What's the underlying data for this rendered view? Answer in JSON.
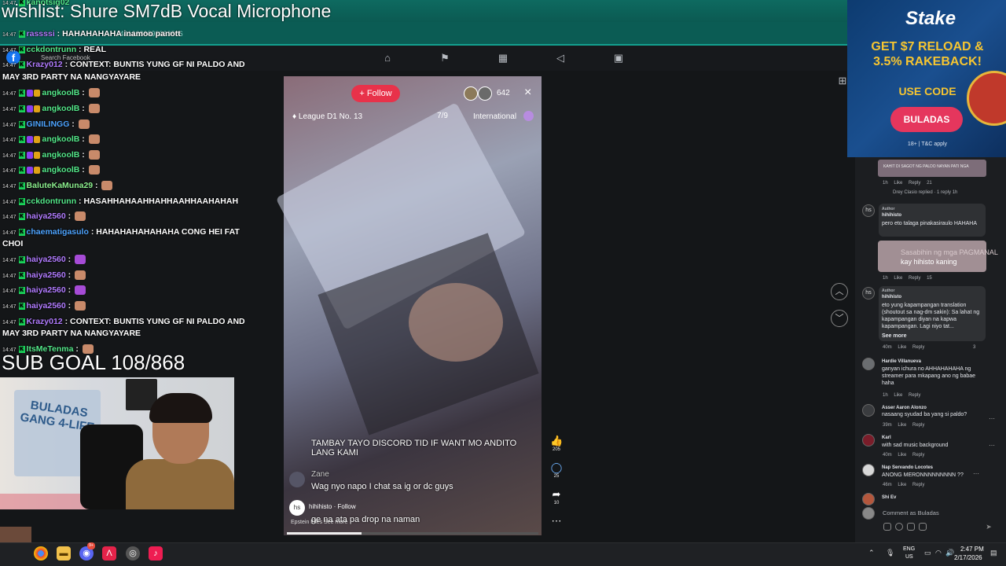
{
  "overlay": {
    "wishlist": "wishlist: Shure SM7dB Vocal Microphone",
    "sub_goal": "SUB GOAL 108/868",
    "counter": "x308",
    "url_fragment": "/4416683893333536",
    "search_placeholder": "Search Facebook"
  },
  "chat": {
    "lines": [
      {
        "time": "14:47",
        "user": "kanotsig02",
        "msg": ""
      },
      {
        "time": "14:47",
        "user": "rassssi",
        "msg": "HAHAHAHAHA inamoo panott"
      },
      {
        "time": "14:47",
        "user": "cckdontrunn",
        "msg": "REAL"
      },
      {
        "time": "14:47",
        "user": "Krazy012",
        "msg": "CONTEXT: BUNTIS YUNG GF NI PALDO AND",
        "cont": "MAY 3RD PARTY NA NANGYAYARE"
      },
      {
        "time": "14:47",
        "user": "angkoolB",
        "msg": ""
      },
      {
        "time": "14:47",
        "user": "angkoolB",
        "msg": ""
      },
      {
        "time": "14:47",
        "user": "GINILINGG",
        "msg": ""
      },
      {
        "time": "14:47",
        "user": "angkoolB",
        "msg": ""
      },
      {
        "time": "14:47",
        "user": "angkoolB",
        "msg": ""
      },
      {
        "time": "14:47",
        "user": "angkoolB",
        "msg": ""
      },
      {
        "time": "14:47",
        "user": "BaluteKaMuna29",
        "msg": ""
      },
      {
        "time": "14:47",
        "user": "cckdontrunn",
        "msg": "HASAHHAHAAHHAHHAAHHAAHAHAH"
      },
      {
        "time": "14:47",
        "user": "haiya2560",
        "msg": ""
      },
      {
        "time": "14:47",
        "user": "chaematigasulo",
        "msg": "HAHAHAHAHAHAHA CONG HEI FAT",
        "cont": "CHOI"
      },
      {
        "time": "14:47",
        "user": "haiya2560",
        "msg": ""
      },
      {
        "time": "14:47",
        "user": "haiya2560",
        "msg": ""
      },
      {
        "time": "14:47",
        "user": "haiya2560",
        "msg": ""
      },
      {
        "time": "14:47",
        "user": "haiya2560",
        "msg": ""
      },
      {
        "time": "14:47",
        "user": "Krazy012",
        "msg": "CONTEXT: BUNTIS YUNG GF NI PALDO AND",
        "cont": "MAY 3RD PARTY NA NANGYAYARE"
      },
      {
        "time": "14:47",
        "user": "ItsMeTenma",
        "msg": ""
      }
    ]
  },
  "webcam": {
    "art_text": "BULADAS GANG 4-LIFE"
  },
  "reel": {
    "follow_label": "+ Follow",
    "viewer_count": "642",
    "close_icon": "×",
    "league": "League D1 No. 13",
    "rank": "7/9",
    "region": "International",
    "comments": [
      {
        "user": "",
        "text": "TAMBAY TAYO DISCORD TID IF WANT MO ANDITO LANG KAMI"
      },
      {
        "user": "Zane",
        "text": "Wag nyo napo I chat sa ig or dc guys"
      },
      {
        "user": "",
        "text": "ge na ata pa drop na naman"
      }
    ],
    "author": "hihihisto",
    "author_follow": "· Follow",
    "caption_fragment": "Epstein Files",
    "see_more": "See more",
    "likes": "205",
    "comment_count": "25",
    "shares": "10"
  },
  "ad": {
    "brand": "Stake",
    "headline": "GET $7 RELOAD & 3.5% RAKEBACK!",
    "use_code": "USE CODE",
    "code": "BULADAS",
    "fine_print": "18+ | T&C apply"
  },
  "comments_panel": {
    "top_meta": {
      "time": "1h",
      "like": "Like",
      "reply": "Reply",
      "reactions": "21"
    },
    "top_reply_text": "Drey Clasio replied · 1 reply",
    "top_reply_time": "1h",
    "top_sticker_text": "KAHIT DI SAGOT NG PALDO NAYAN PATI NGA",
    "sticker_ghost": "Sasabihin ng mga PAGMANAL",
    "sticker_text": "kay hihisto kaning",
    "items": [
      {
        "badge": "Author",
        "name": "hihihisto",
        "text": "pero eto talaga pinakasiraulo HAHAHA",
        "time": "1h",
        "like": "Like",
        "reply": "Reply",
        "reactions": "15"
      },
      {
        "badge": "Author",
        "name": "hihihisto",
        "text": "eto yung kapampangan translation (shoutout sa nag-dm sakin): Sa lahat ng kapampangan diyan na kapwa kapampangan. Lagi niyo tat...",
        "see_more": "See more",
        "time": "40m",
        "like": "Like",
        "reply": "Reply",
        "reactions": "3"
      },
      {
        "name": "Hardie Villanueva",
        "text": "ganyan ichura no AHHAHAHAHA ng streamer para mkapang ano ng babae haha",
        "time": "1h",
        "like": "Like",
        "reply": "Reply"
      },
      {
        "name": "Asser Aaron Alonzo",
        "text": "nasaang syudad ba yang si paldo?",
        "time": "39m",
        "like": "Like",
        "reply": "Reply"
      },
      {
        "name": "Karl",
        "text": "with sad music background",
        "time": "40m",
        "like": "Like",
        "reply": "Reply"
      },
      {
        "name": "Nap Servando Locotes",
        "text": "ANONG MERONNNNNNNNN ??",
        "time": "46m",
        "like": "Like",
        "reply": "Reply"
      },
      {
        "name": "Shi Ev",
        "text": ""
      }
    ],
    "input_placeholder": "Comment as Buladas"
  },
  "taskbar": {
    "lang_top": "ENG",
    "lang_bottom": "US",
    "time": "2:47 PM",
    "date": "2/17/2026",
    "discord_badge": "9+"
  },
  "colors": {
    "accent_teal": "#0b5c54",
    "follow_red": "#e8324a",
    "stake_gold": "#f6c531",
    "code_pink": "#e5365d"
  }
}
